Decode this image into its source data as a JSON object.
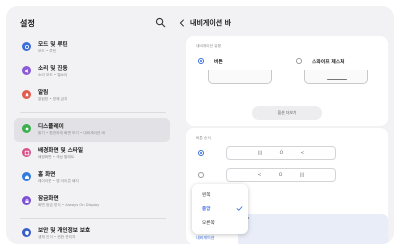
{
  "colors": {
    "accent": "#3a6fe0",
    "background": "#f2f2f4",
    "card": "#ffffff",
    "selected": "#e2e2e6"
  },
  "left": {
    "title": "설정",
    "search_icon": "search-icon",
    "items": [
      {
        "label": "모드 및 루틴",
        "sub": "모드 • 루틴",
        "icon": "modes-icon",
        "color": "#3b6fd8"
      },
      {
        "label": "소리 및 진동",
        "sub": "소리 모드 • 벨소리",
        "icon": "sound-icon",
        "color": "#8a5bd6"
      },
      {
        "label": "알림",
        "sub": "알림창 • 방해 금지",
        "icon": "notification-icon",
        "color": "#e35a4f"
      },
      {
        "label": "디스플레이",
        "sub": "밝기 • 편안하게 화면 보기 • 내비게이션 바",
        "icon": "display-icon",
        "color": "#3bb04d"
      },
      {
        "label": "배경화면 및 스타일",
        "sub": "배경화면 • 색상 팔레트",
        "icon": "wallpaper-icon",
        "color": "#d84f8a"
      },
      {
        "label": "홈 화면",
        "sub": "레이아웃 • 앱 아이콘 배지",
        "icon": "home-icon",
        "color": "#2f7de0"
      },
      {
        "label": "잠금화면",
        "sub": "화면 잠금 방식 • Always On Display",
        "icon": "lock-icon",
        "color": "#7b4fd6"
      },
      {
        "label": "보안 및 개인정보 보호",
        "sub": "생체 인식 • 권한 관리자",
        "icon": "security-icon",
        "color": "#3a5fc8"
      }
    ]
  },
  "right": {
    "title": "내비게이션 바",
    "section_type": "내비게이션 유형",
    "option_buttons": "버튼",
    "option_swipe": "스와이프 제스처",
    "more_options": "옵션 더보기",
    "section_order": "버튼 순서",
    "order_a": [
      "|||",
      "O",
      "<"
    ],
    "order_b": [
      "<",
      "O",
      "|||"
    ],
    "cut_question": "?",
    "cut_link": "내비게이션"
  },
  "popup": {
    "items": [
      "왼쪽",
      "중앙",
      "오른쪽"
    ],
    "selected": "중앙"
  }
}
